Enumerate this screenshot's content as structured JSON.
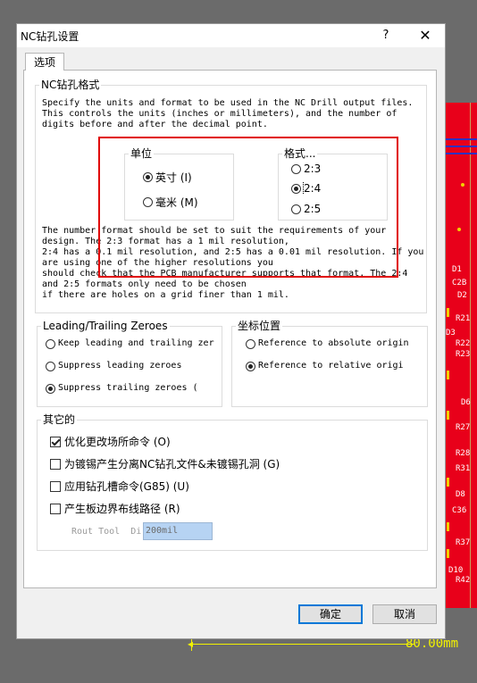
{
  "window": {
    "title": "NC钻孔设置",
    "help_glyph": "?",
    "close_glyph": "✕"
  },
  "tabs": [
    {
      "label": "选项"
    }
  ],
  "format_group": {
    "title": "NC钻孔格式",
    "description": "Specify the units and format to be used in the NC Drill output files.\nThis controls the units (inches or millimeters), and the number of\ndigits before and after the decimal point.",
    "units": {
      "title": "单位",
      "options": [
        {
          "label": "英寸 (I)",
          "selected": true
        },
        {
          "label": "毫米 (M)",
          "selected": false
        }
      ]
    },
    "format": {
      "title": "格式...",
      "options": [
        {
          "label": "2:3",
          "selected": false
        },
        {
          "label": "2:4",
          "selected": true
        },
        {
          "label": "2:5",
          "selected": false
        }
      ]
    },
    "note": "The number format should be set to suit the requirements of your\ndesign. The 2:3 format has a 1 mil resolution,\n2:4 has a 0.1 mil resolution, and 2:5 has a 0.01 mil resolution. If you\nare using one of the higher resolutions you\nshould check that the PCB manufacturer supports that format. The 2:4\nand 2:5 formats only need to be chosen\nif there are holes on a grid finer than 1 mil."
  },
  "zeroes_group": {
    "title": "Leading/Trailing Zeroes",
    "options": [
      {
        "label": "Keep leading and trailing zer",
        "selected": false
      },
      {
        "label": "Suppress leading zeroes",
        "selected": false
      },
      {
        "label": "Suppress trailing zeroes (",
        "selected": true
      }
    ]
  },
  "coord_group": {
    "title": "坐标位置",
    "options": [
      {
        "label": "Reference to absolute origin",
        "selected": false
      },
      {
        "label": "Reference to relative origi",
        "selected": true
      }
    ]
  },
  "other_group": {
    "title": "其它的",
    "checks": [
      {
        "label": "优化更改场所命令 (O)",
        "checked": true
      },
      {
        "label": "为镀锡产生分离NC钻孔文件&未镀锡孔洞 (G)",
        "checked": false
      },
      {
        "label": "应用钻孔槽命令(G85) (U)",
        "checked": false
      },
      {
        "label": "产生板边界布线路径 (R)",
        "checked": false
      }
    ],
    "rout_tool_label": "Rout Tool  Di:",
    "rout_tool_value": "200mil"
  },
  "buttons": {
    "ok": "确定",
    "cancel": "取消"
  },
  "background": {
    "pcb_labels": [
      "D1",
      "C2B",
      "D2",
      "R21",
      "D3",
      "R22",
      "R23",
      "D6",
      "R27",
      "R28",
      "R31",
      "D8",
      "C36",
      "R37",
      "D10",
      "R42"
    ],
    "dimension_text": "80.00mm"
  },
  "colors": {
    "annotation_box": "#e00000",
    "pcb_red": "#e8001a",
    "dimension_yellow": "#f2f200",
    "default_button_border": "#0078d7"
  }
}
